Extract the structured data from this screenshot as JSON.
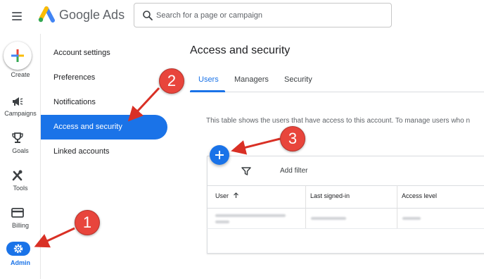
{
  "app": {
    "brand": "Google Ads"
  },
  "search": {
    "placeholder": "Search for a page or campaign"
  },
  "rail": {
    "create": "Create",
    "campaigns": "Campaigns",
    "goals": "Goals",
    "tools": "Tools",
    "billing": "Billing",
    "admin": "Admin"
  },
  "subnav": {
    "items": [
      "Account settings",
      "Preferences",
      "Notifications",
      "Access and security",
      "Linked accounts"
    ],
    "active_index": 3
  },
  "main": {
    "title": "Access and security",
    "tabs": [
      "Users",
      "Managers",
      "Security"
    ],
    "active_tab": 0,
    "description": "This table shows the users that have access to this account. To manage users who n"
  },
  "table": {
    "add_filter": "Add filter",
    "columns": [
      "User",
      "Last signed-in",
      "Access level"
    ]
  },
  "annotations": {
    "badges": [
      "1",
      "2",
      "3"
    ]
  },
  "colors": {
    "accent": "#1a73e8",
    "annotation": "#e8453c"
  }
}
